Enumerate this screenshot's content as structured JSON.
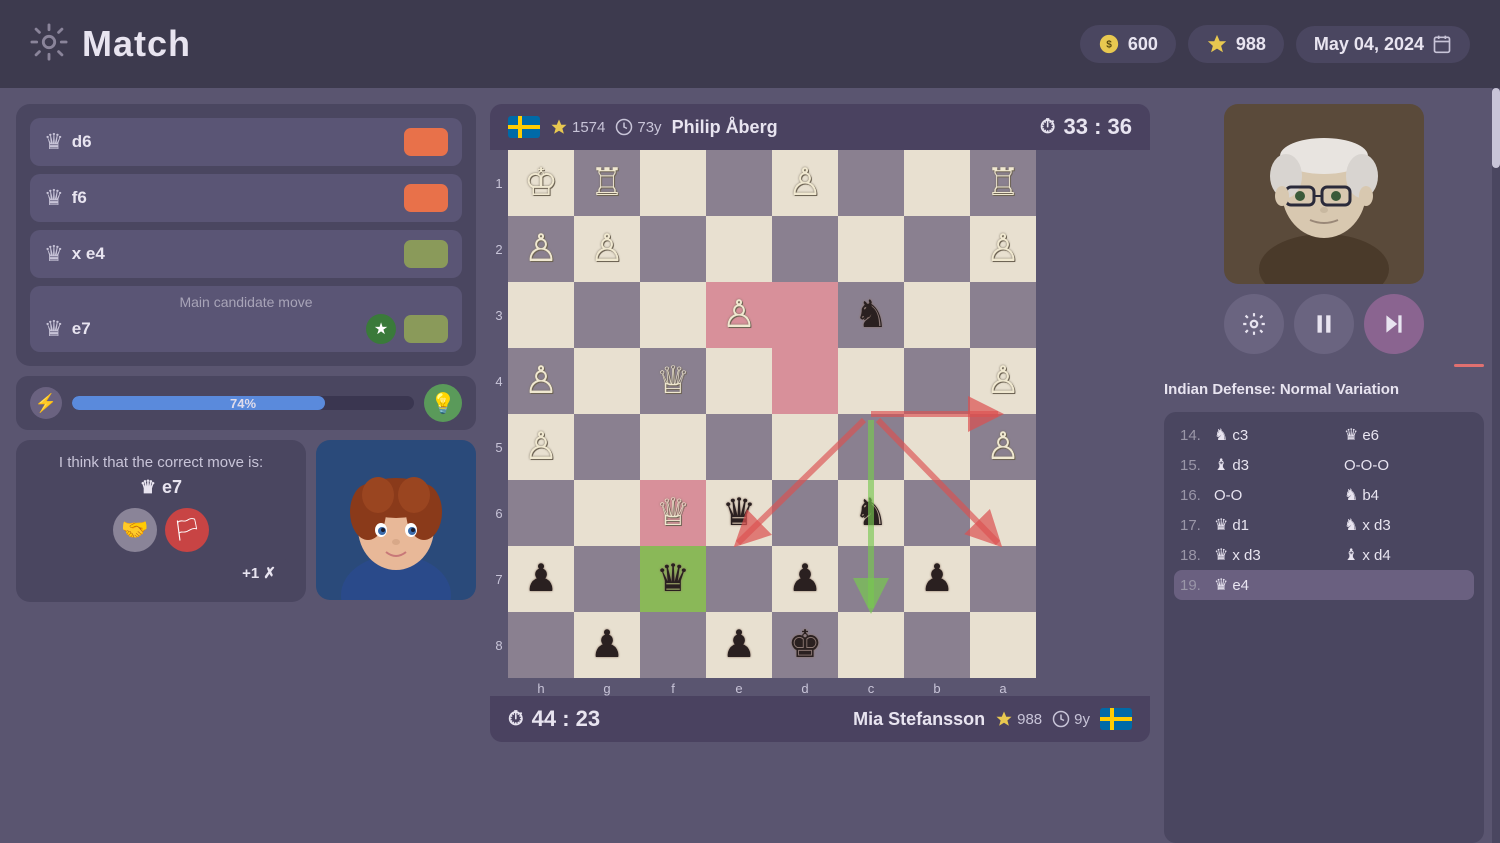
{
  "header": {
    "title": "Match",
    "currency": "600",
    "stars": "988",
    "date": "May 04, 2024"
  },
  "moves": [
    {
      "piece": "♛",
      "coord": "d6",
      "color": "orange"
    },
    {
      "piece": "♛",
      "coord": "f6",
      "color": "orange"
    },
    {
      "piece": "♛",
      "coord": "x e4",
      "color": "olive"
    }
  ],
  "candidate": {
    "label": "Main candidate move",
    "piece": "♛",
    "coord": "e7",
    "color": "olive"
  },
  "progress": {
    "value": 74,
    "text": "74%"
  },
  "ai_suggestion": {
    "text": "I think that the correct move is:",
    "piece": "♛",
    "coord": "e7"
  },
  "player_bottom": {
    "name": "Mia Stefansson",
    "rating": "988",
    "age": "9y",
    "flag": "SE",
    "timer": "44 : 23"
  },
  "player_top": {
    "name": "Philip Åberg",
    "rating": "1574",
    "age": "73y",
    "flag": "SE",
    "timer": "33 : 36"
  },
  "opening": "Indian Defense: Normal Variation",
  "move_history": [
    {
      "num": "14.",
      "white_piece": "♞",
      "white_move": "c3",
      "black_piece": "♛",
      "black_move": "e6"
    },
    {
      "num": "15.",
      "white_piece": "♝",
      "white_move": "d3",
      "black_piece": "",
      "black_move": "O-O-O"
    },
    {
      "num": "16.",
      "white_piece": "",
      "white_move": "O-O",
      "black_piece": "♞",
      "black_move": "b4"
    },
    {
      "num": "17.",
      "white_piece": "♛",
      "white_move": "d1",
      "black_piece": "♞",
      "black_move": "x d3"
    },
    {
      "num": "18.",
      "white_piece": "♛",
      "white_move": "x d3",
      "black_piece": "♝",
      "black_move": "x d4"
    },
    {
      "num": "19.",
      "white_piece": "♛",
      "white_move": "e4",
      "black_piece": "",
      "black_move": ""
    }
  ],
  "controls": {
    "settings": "⚙",
    "pause": "⏸",
    "skip": "⏭"
  },
  "extra": "+1 ✗"
}
